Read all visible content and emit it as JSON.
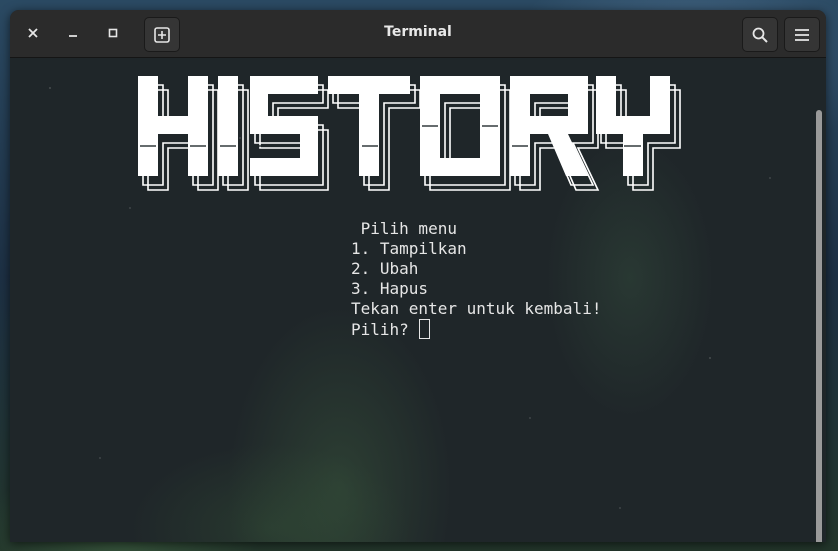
{
  "window": {
    "title": "Terminal"
  },
  "titlebar": {
    "icons": [
      "close-icon",
      "minimize-icon",
      "maximize-icon",
      "new-tab-icon",
      "search-icon",
      "hamburger-menu-icon"
    ]
  },
  "terminal": {
    "banner_text": "HISTORY",
    "lines": [
      " Pilih menu",
      "1. Tampilkan",
      "2. Ubah",
      "3. Hapus",
      "Tekan enter untuk kembali!"
    ],
    "prompt": "Pilih?",
    "input_value": ""
  },
  "colors": {
    "titlebar": "#2b2b2b",
    "terminal_bg": "#1f2629",
    "text": "#e6e6e6",
    "banner": "#ffffff"
  }
}
